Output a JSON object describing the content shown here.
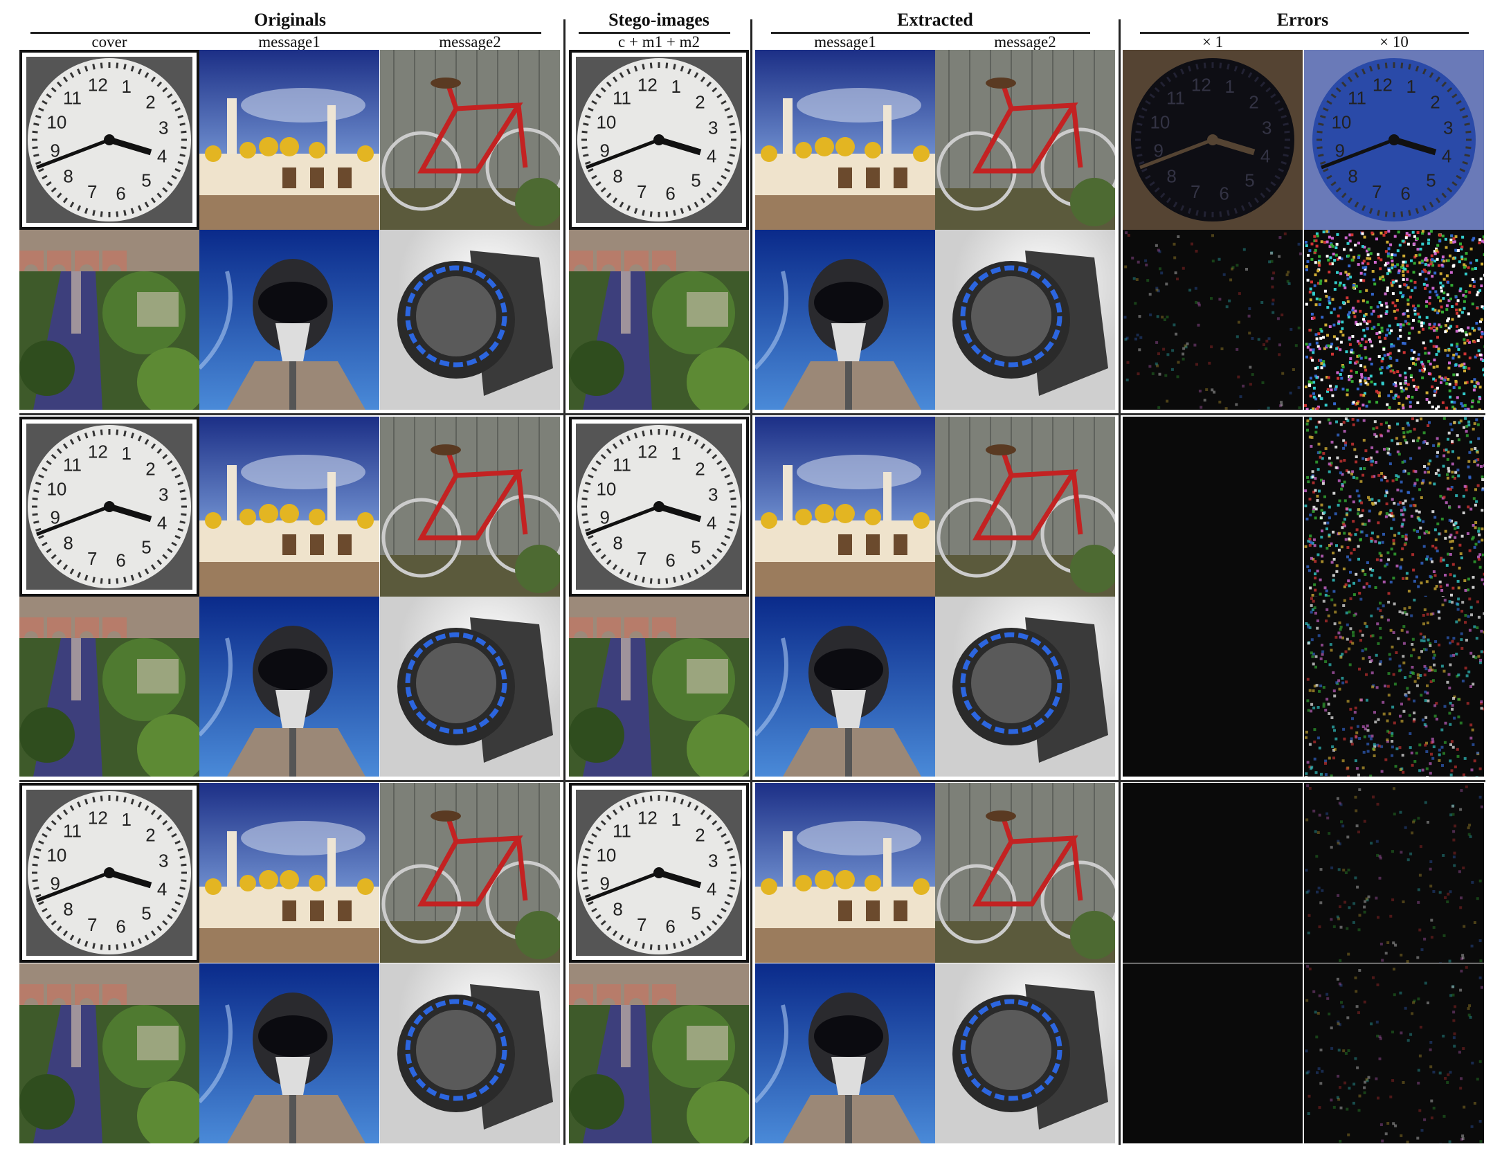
{
  "groups": {
    "originals": {
      "title": "Originals",
      "cols": [
        "cover",
        "message1",
        "message2"
      ]
    },
    "stego": {
      "title": "Stego-images",
      "cols": [
        "c + m1 + m2"
      ]
    },
    "extracted": {
      "title": "Extracted",
      "cols": [
        "message1",
        "message2"
      ]
    },
    "errors": {
      "title": "Errors",
      "cols": [
        "× 1",
        "× 10"
      ]
    }
  }
}
